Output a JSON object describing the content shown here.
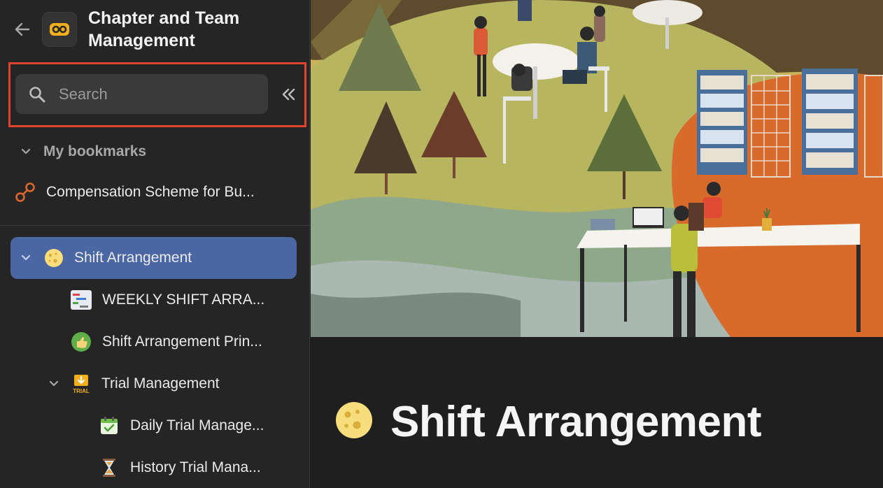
{
  "sidebar": {
    "title": "Chapter and Team Management",
    "search": {
      "placeholder": "Search",
      "value": ""
    },
    "bookmarks_section": {
      "label": "My bookmarks"
    },
    "bookmarks": [
      {
        "label": "Compensation Scheme for Bu...",
        "icon": "link-icon"
      }
    ],
    "tree": [
      {
        "label": "Shift Arrangement",
        "icon": "moon-icon",
        "active": true,
        "expanded": true
      },
      {
        "label": "WEEKLY SHIFT ARRA...",
        "icon": "gantt-icon"
      },
      {
        "label": "Shift Arrangement Prin...",
        "icon": "thumbs-up-icon"
      },
      {
        "label": "Trial Management",
        "icon": "trial-icon",
        "expanded": true
      },
      {
        "label": "Daily Trial Manage...",
        "icon": "calendar-check-icon"
      },
      {
        "label": "History Trial Mana...",
        "icon": "hourglass-icon"
      }
    ]
  },
  "main": {
    "page_title": "Shift Arrangement",
    "page_icon": "moon-icon"
  },
  "colors": {
    "active_item": "#4a67a3",
    "highlight_box": "#e2432e",
    "logo_accent": "#f2b01e"
  }
}
